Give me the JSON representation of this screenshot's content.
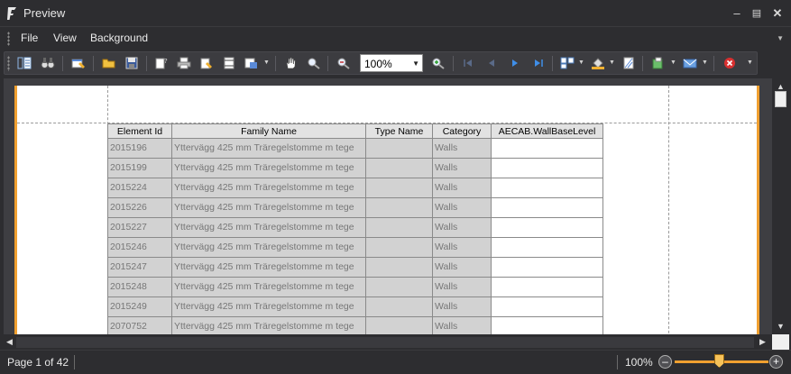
{
  "window": {
    "title": "Preview"
  },
  "menu": {
    "items": [
      "File",
      "View",
      "Background"
    ]
  },
  "toolbar": {
    "zoom_value": "100%"
  },
  "table": {
    "columns": [
      "Element Id",
      "Family Name",
      "Type Name",
      "Category",
      "AECAB.WallBaseLevel"
    ],
    "rows": [
      [
        "2015196",
        "Yttervägg 425 mm Träregelstomme m tege",
        "",
        "Walls",
        ""
      ],
      [
        "2015199",
        "Yttervägg 425 mm Träregelstomme m tege",
        "",
        "Walls",
        ""
      ],
      [
        "2015224",
        "Yttervägg 425 mm Träregelstomme m tege",
        "",
        "Walls",
        ""
      ],
      [
        "2015226",
        "Yttervägg 425 mm Träregelstomme m tege",
        "",
        "Walls",
        ""
      ],
      [
        "2015227",
        "Yttervägg 425 mm Träregelstomme m tege",
        "",
        "Walls",
        ""
      ],
      [
        "2015246",
        "Yttervägg 425 mm Träregelstomme m tege",
        "",
        "Walls",
        ""
      ],
      [
        "2015247",
        "Yttervägg 425 mm Träregelstomme m tege",
        "",
        "Walls",
        ""
      ],
      [
        "2015248",
        "Yttervägg 425 mm Träregelstomme m tege",
        "",
        "Walls",
        ""
      ],
      [
        "2015249",
        "Yttervägg 425 mm Träregelstomme m tege",
        "",
        "Walls",
        ""
      ],
      [
        "2070752",
        "Yttervägg 425 mm Träregelstomme m tege",
        "",
        "Walls",
        ""
      ]
    ]
  },
  "status": {
    "page_info": "Page 1 of 42",
    "zoom_percent": "100%",
    "zoom_level": 0.65
  },
  "colors": {
    "accent": "#f0a030",
    "chrome": "#2d2d30"
  }
}
